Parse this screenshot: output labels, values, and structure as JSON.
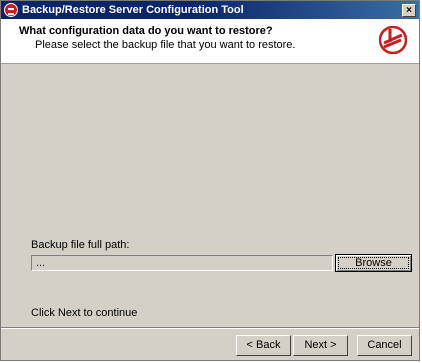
{
  "window": {
    "title": "Backup/Restore Server Configuration Tool"
  },
  "header": {
    "title": "What configuration data do you want to restore?",
    "subtitle": "Please select the backup file that you want to restore."
  },
  "form": {
    "path_label": "Backup file full path:",
    "path_value": "...",
    "browse_label": "Browse"
  },
  "footer": {
    "hint": "Click Next to continue",
    "back_label": "< Back",
    "next_label": "Next >",
    "cancel_label": "Cancel"
  },
  "icons": {
    "app": "app-logo-icon",
    "close": "close-icon",
    "header_logo": "brand-logo-icon"
  },
  "colors": {
    "titlebar": "#0a246a",
    "dialog_bg": "#d4d0c8",
    "logo_red": "#c81e1e"
  }
}
